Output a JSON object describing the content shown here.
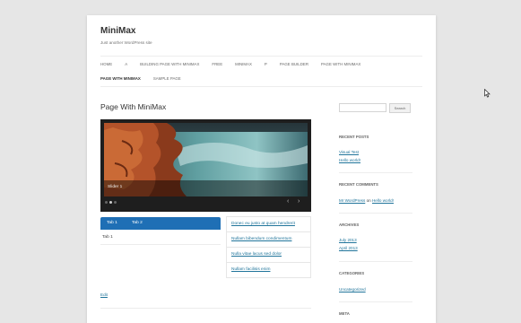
{
  "site": {
    "title": "MiniMax",
    "description": "Just another WordPress site"
  },
  "nav": {
    "row1": [
      "HOME",
      "A",
      "BUILDING PAGE WITH MINIMAX",
      "FREE",
      "MINIMAX",
      "P",
      "PAGE BUILDER",
      "PAGE WITH MINIMAX"
    ],
    "row2": [
      "PAGE WITH MINIMAX",
      "SAMPLE PAGE"
    ]
  },
  "entry": {
    "title": "Page With MiniMax",
    "edit_label": "Edit"
  },
  "slider": {
    "caption": "Slider 1",
    "dots_total": 3,
    "active_dot": 1,
    "prev_icon": "‹",
    "next_icon": "›"
  },
  "tabs": {
    "items": [
      "Tab 1",
      "Tab 2"
    ],
    "active_content": "Tab 1",
    "color": "#1f6fb5"
  },
  "links": [
    "Donec eu justo at quam hendrerit",
    "Nullam bibendum condimentum",
    "Nulla vitae lacus sed dolor",
    "Nullam facilisis enim"
  ],
  "sidebar": {
    "search_button": "Search",
    "recent_posts": {
      "title": "RECENT POSTS",
      "items": [
        "Visual Test",
        "Hello world!"
      ]
    },
    "recent_comments": {
      "title": "RECENT COMMENTS",
      "author": "Mr WordPress",
      "on": "on",
      "post": "Hello world!"
    },
    "archives": {
      "title": "ARCHIVES",
      "items": [
        "July 2013",
        "April 2013"
      ]
    },
    "categories": {
      "title": "CATEGORIES",
      "items": [
        "Uncategorized"
      ]
    },
    "meta": {
      "title": "META"
    }
  },
  "colors": {
    "link": "#21759b",
    "background": "#e6e6e6"
  }
}
